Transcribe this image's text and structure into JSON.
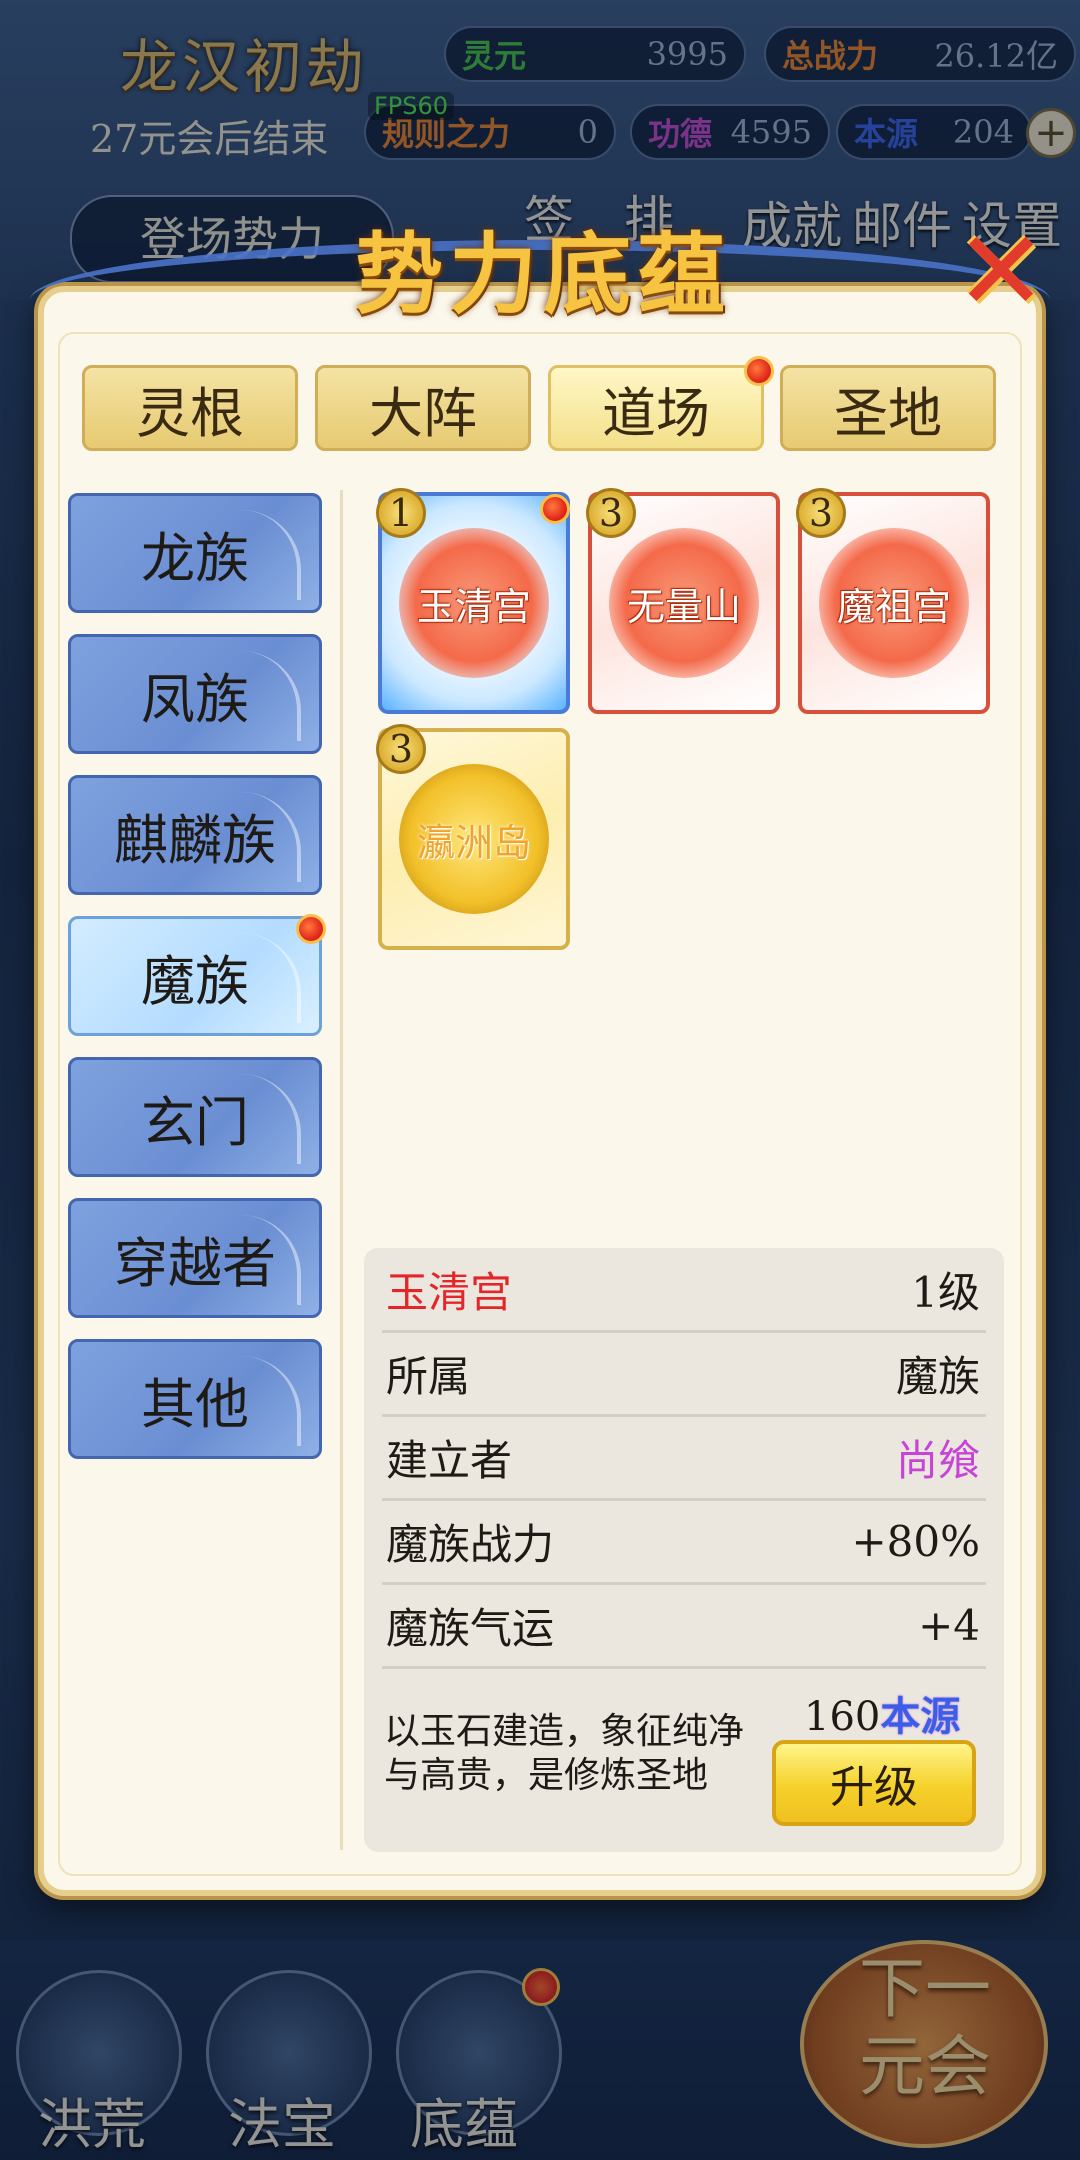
{
  "hud": {
    "game_title": "龙汉初劫",
    "countdown": "27元会后结束",
    "fps": "FPS60",
    "stats": [
      {
        "label": "灵元",
        "value": "3995",
        "color": "#46c046"
      },
      {
        "label": "总战力",
        "value": "26.12亿",
        "color": "#e5802a"
      },
      {
        "label": "规则之力",
        "value": "0",
        "color": "#e5802a"
      },
      {
        "label": "功德",
        "value": "4595",
        "color": "#c04ac8"
      },
      {
        "label": "本源",
        "value": "204",
        "color": "#3a62e6"
      }
    ],
    "plus_label": "+",
    "side_buttons": [
      "登场势力",
      "签",
      "排",
      "成就",
      "邮件",
      "设置"
    ]
  },
  "dialog": {
    "title": "势力底蕴",
    "close_label": "✕",
    "tabs": [
      {
        "label": "灵根",
        "active": false
      },
      {
        "label": "大阵",
        "active": false
      },
      {
        "label": "道场",
        "active": true,
        "notify": true
      },
      {
        "label": "圣地",
        "active": false
      }
    ],
    "factions": [
      {
        "label": "龙族",
        "active": false
      },
      {
        "label": "凤族",
        "active": false
      },
      {
        "label": "麒麟族",
        "active": false
      },
      {
        "label": "魔族",
        "active": true,
        "notify": true
      },
      {
        "label": "玄门",
        "active": false
      },
      {
        "label": "穿越者",
        "active": false
      },
      {
        "label": "其他",
        "active": false
      }
    ],
    "cards": [
      {
        "name": "玉清宫",
        "level": "1",
        "style": "blue",
        "notify": true
      },
      {
        "name": "无量山",
        "level": "3",
        "style": "red"
      },
      {
        "name": "魔祖宫",
        "level": "3",
        "style": "red"
      },
      {
        "name": "瀛洲岛",
        "level": "3",
        "style": "gold"
      }
    ],
    "detail": {
      "name": "玉清宫",
      "level": "1级",
      "rows": [
        {
          "key": "所属",
          "value": "魔族"
        },
        {
          "key": "建立者",
          "value": "尚飨"
        },
        {
          "key": "魔族战力",
          "value": "+80%"
        },
        {
          "key": "魔族气运",
          "value": "+4"
        }
      ],
      "description": "以玉石建造，象征纯净与高贵，是修炼圣地",
      "cost_amount": "160",
      "cost_unit": "本源",
      "upgrade_label": "升级"
    }
  },
  "bottom_nav": [
    {
      "label": "洪荒"
    },
    {
      "label": "法宝"
    },
    {
      "label": "底蕴",
      "notify": true
    }
  ],
  "next_era_label": "下一元会"
}
